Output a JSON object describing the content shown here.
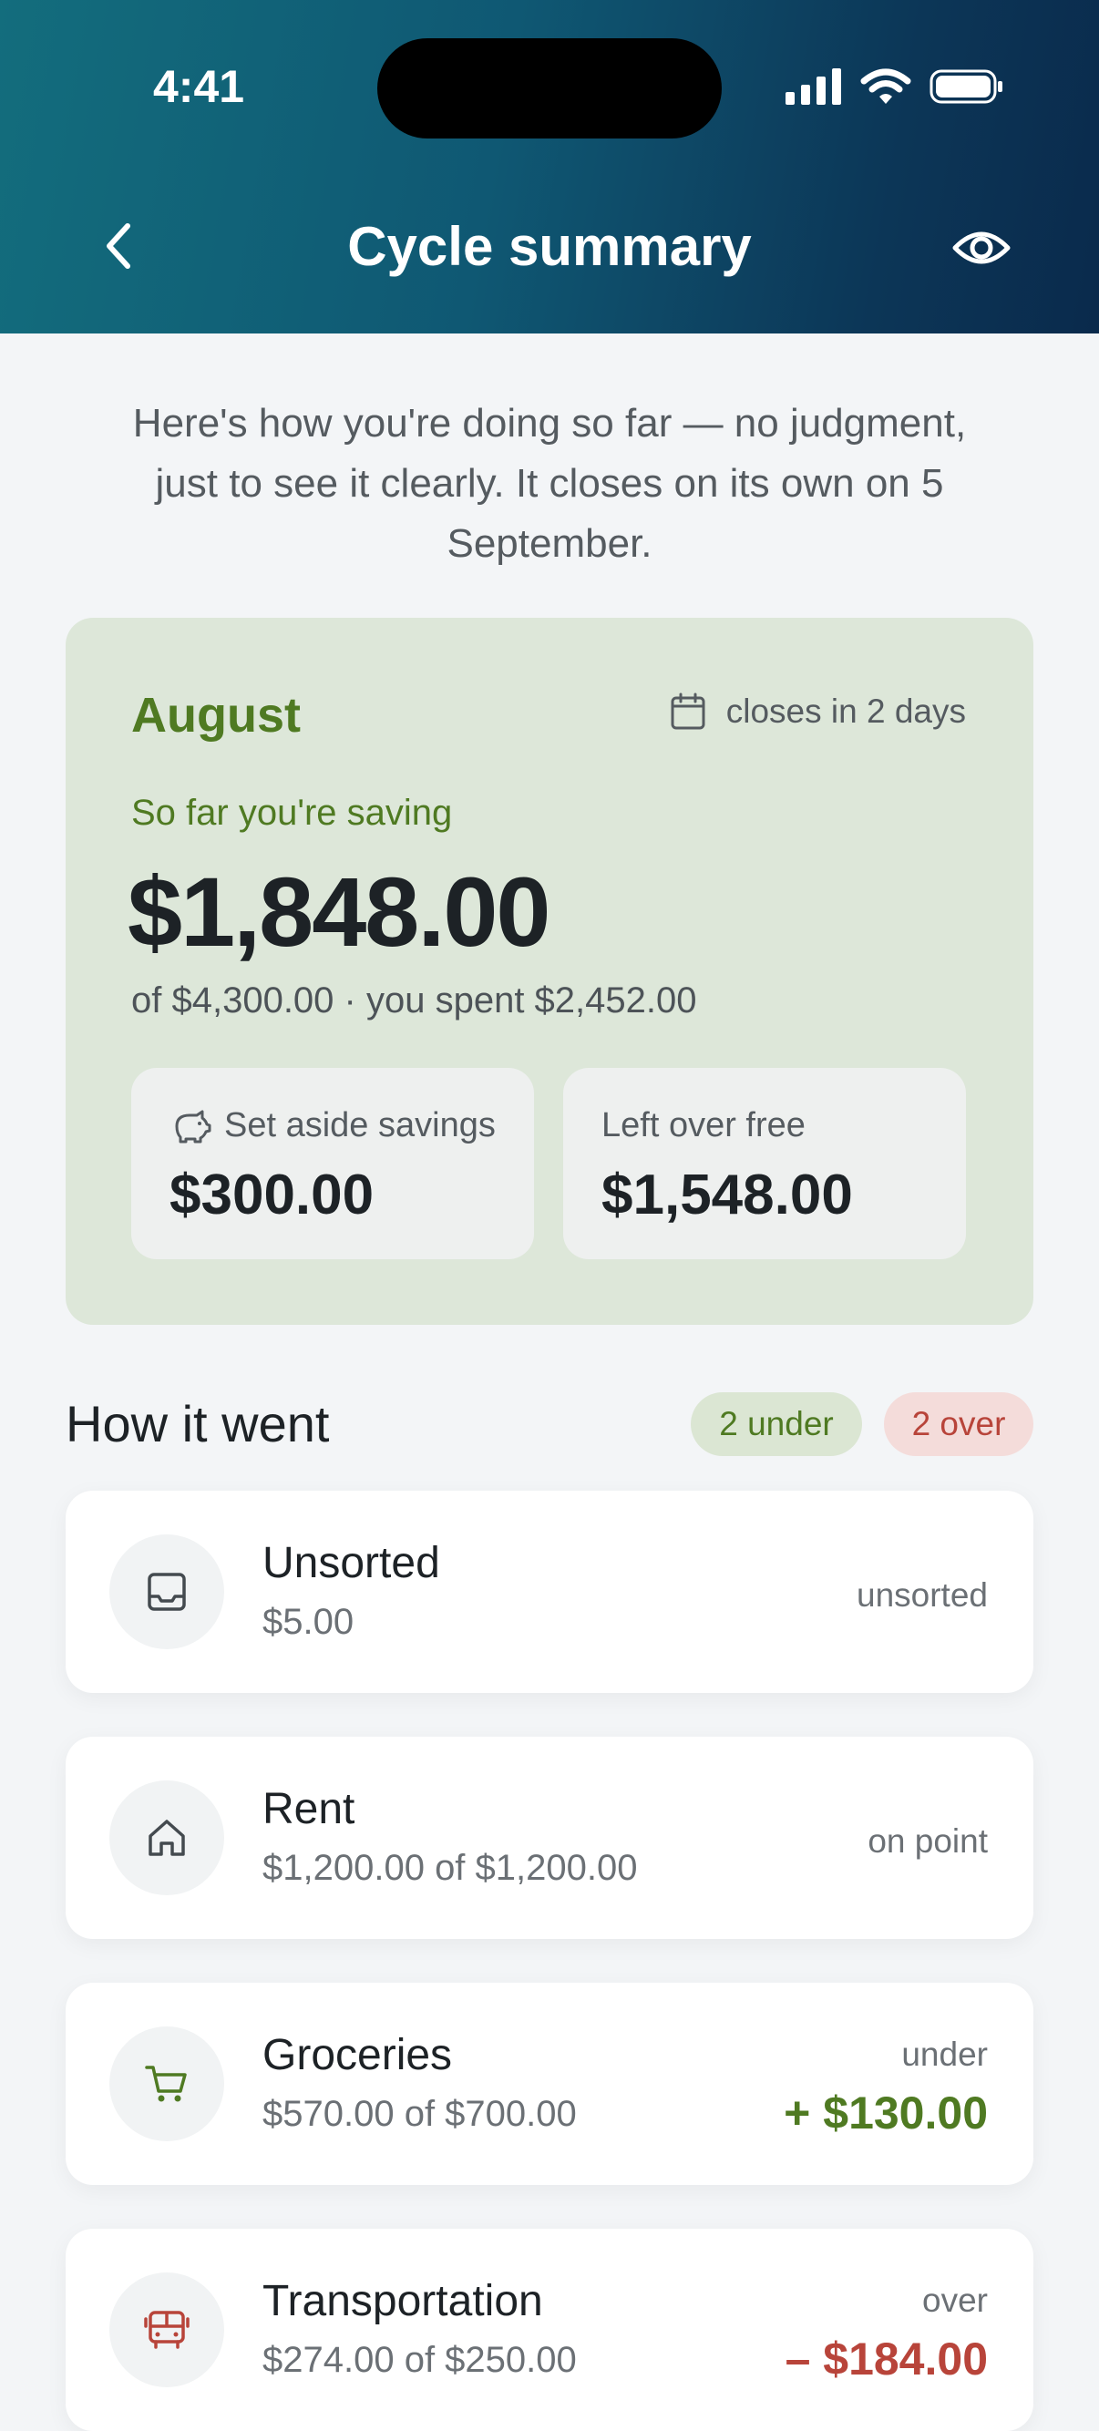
{
  "status_bar": {
    "time": "4:41"
  },
  "nav": {
    "title": "Cycle summary"
  },
  "intro": "Here's how you're doing so far — no judgment, just to see it clearly. It closes on its own on 5 September.",
  "summary": {
    "month": "August",
    "closes": "closes in 2 days",
    "saving_label": "So far you're saving",
    "saving_amount": "$1,848.00",
    "sub": "of $4,300.00 · you spent $2,452.00",
    "set_aside_label": "Set aside savings",
    "set_aside_value": "$300.00",
    "left_over_label": "Left over free",
    "left_over_value": "$1,548.00"
  },
  "section": {
    "title": "How it went",
    "under_pill": "2 under",
    "over_pill": "2 over"
  },
  "categories": [
    {
      "name": "Unsorted",
      "amount": "$5.00",
      "status": "unsorted",
      "diff": "",
      "icon": "inbox-icon"
    },
    {
      "name": "Rent",
      "amount": "$1,200.00 of $1,200.00",
      "status": "on point",
      "diff": "",
      "icon": "home-icon"
    },
    {
      "name": "Groceries",
      "amount": "$570.00 of $700.00",
      "status": "under",
      "diff": "+ $130.00",
      "icon": "cart-icon"
    },
    {
      "name": "Transportation",
      "amount": "$274.00 of $250.00",
      "status": "over",
      "diff": "– $184.00",
      "icon": "bus-icon"
    }
  ],
  "colors": {
    "accent_green": "#4f7a22",
    "accent_red": "#b8443a",
    "header_start": "#136d7d",
    "header_end": "#0a2a4c"
  }
}
